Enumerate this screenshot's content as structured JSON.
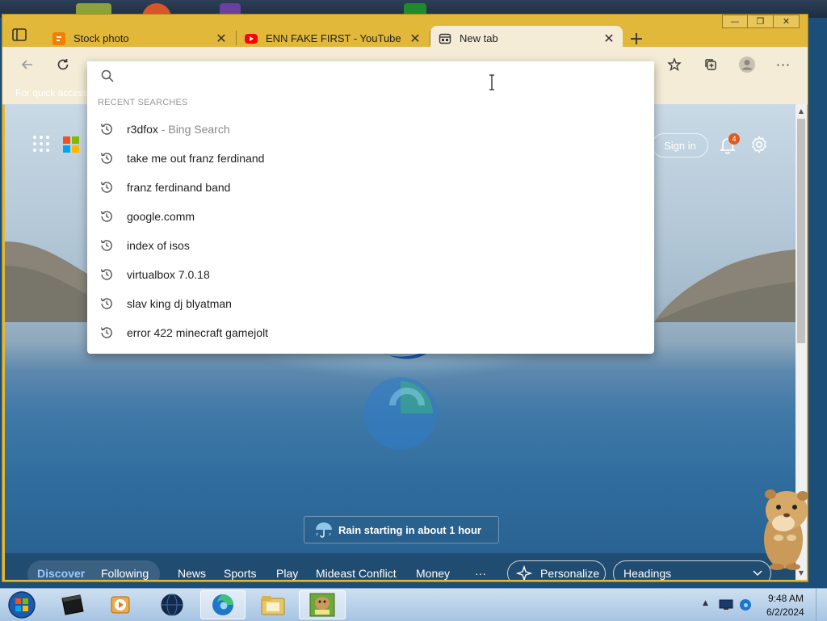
{
  "window": {
    "tabs": [
      {
        "title": "Stock photo",
        "favicon": "blogger-icon",
        "color": "#f57d00",
        "active": false
      },
      {
        "title": "ENN FAKE FIRST - YouTube",
        "favicon": "youtube-icon",
        "color": "#ff0000",
        "active": false
      },
      {
        "title": "New tab",
        "favicon": "newtab-icon",
        "color": "#333333",
        "active": true
      }
    ],
    "frame_color": "#e2b83a"
  },
  "favorites_bar": {
    "hint": "For quick access"
  },
  "omnibox": {
    "value": "",
    "section_label": "RECENT SEARCHES",
    "suggestions": [
      {
        "text": "r3dfox",
        "suffix": " - Bing Search"
      },
      {
        "text": "take me out franz ferdinand",
        "suffix": ""
      },
      {
        "text": "franz ferdinand band",
        "suffix": ""
      },
      {
        "text": "google.comm",
        "suffix": ""
      },
      {
        "text": "index of isos",
        "suffix": ""
      },
      {
        "text": "virtualbox 7.0.18",
        "suffix": ""
      },
      {
        "text": "slav king dj blyatman",
        "suffix": ""
      },
      {
        "text": "error 422 minecraft gamejolt",
        "suffix": ""
      }
    ]
  },
  "ntp": {
    "sign_in": "Sign in",
    "notification_count": "4",
    "weather": "Rain starting in about 1 hour"
  },
  "feed": {
    "items": [
      "Discover",
      "Following",
      "News",
      "Sports",
      "Play",
      "Mideast Conflict",
      "Money",
      "···"
    ],
    "personalize": "Personalize",
    "headings_select": "Headings"
  },
  "taskbar": {
    "time": "9:48 AM",
    "date": "6/2/2024",
    "pinned": [
      "start-orb",
      "terminal-icon",
      "media-player-icon",
      "globe-browser-icon",
      "edge-icon",
      "file-explorer-icon",
      "bandicam-box-icon"
    ]
  }
}
